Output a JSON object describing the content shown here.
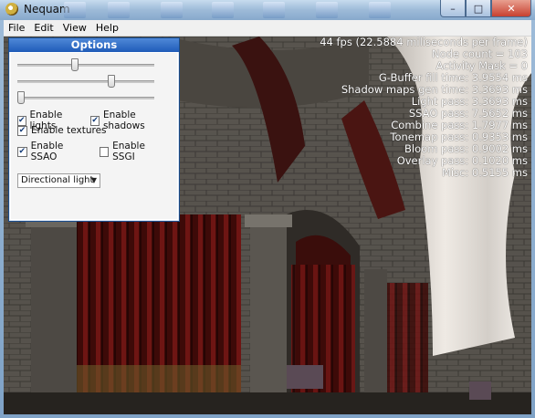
{
  "window": {
    "title": "Nequam"
  },
  "menu": [
    "File",
    "Edit",
    "View",
    "Help"
  ],
  "stats": [
    "44 fps (22.5884 miliseconds per frame)",
    "Node count = 103",
    "Activity Mask = 0",
    "G-Buffer fill time: 3.9554 ms",
    "Shadow maps gen time: 3.3693 ms",
    "Light pass: 3.3693 ms",
    "SSAO pass: 7.5652 ms",
    "Combine pass: 1.7977 ms",
    "Tonemap pass: 0.9353 ms",
    "Bloom pass: 0.9002 ms",
    "Overlay pass: 0.1020 ms",
    "Misc: 0.5155 ms"
  ],
  "options": {
    "title": "Options",
    "sliders": [
      {
        "value": 0.41
      },
      {
        "value": 0.68
      },
      {
        "value": 0.02
      }
    ],
    "checkboxes": [
      {
        "label": "Enable lights",
        "checked": true
      },
      {
        "label": "Enable shadows",
        "checked": true
      },
      {
        "label": "Enable textures",
        "checked": true
      },
      {
        "label": "Enable SSAO",
        "checked": true
      },
      {
        "label": "Enable SSGI",
        "checked": false
      }
    ],
    "light_type": "Directional light"
  },
  "colors": {
    "panel_header": "#1f5bb8",
    "stats_text": "#ffffff"
  }
}
